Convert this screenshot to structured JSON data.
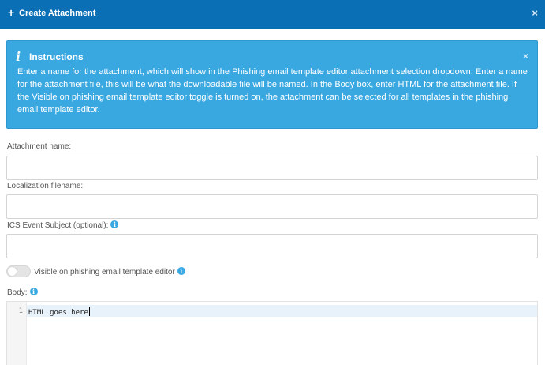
{
  "modal": {
    "title": "Create Attachment",
    "plus_glyph": "+",
    "close_glyph": "×"
  },
  "instructions": {
    "title": "Instructions",
    "icon_glyph": "i",
    "close_glyph": "×",
    "body": "Enter a name for the attachment, which will show in the Phishing email template editor attachment selection dropdown. Enter a name for the attachment file, this will be what the downloadable file will be named. In the Body box, enter HTML for the attachment file. If the Visible on phishing email template editor toggle is turned on, the attachment can be selected for all templates in the phishing email template editor."
  },
  "form": {
    "attachment_name_label": "Attachment name:",
    "attachment_name_value": "",
    "localization_filename_label": "Localization filename:",
    "localization_filename_value": "",
    "ics_subject_label": "ICS Event Subject (optional):",
    "ics_subject_value": "",
    "visible_toggle_label": "Visible on phishing email template editor",
    "visible_toggle_on": false,
    "body_label": "Body:",
    "info_glyph": "i"
  },
  "editor": {
    "line_numbers": [
      "1"
    ],
    "lines": [
      "HTML goes here"
    ]
  },
  "colors": {
    "header": "#0b6fb5",
    "alert": "#39a8e1",
    "info_icon": "#39a8e1"
  }
}
